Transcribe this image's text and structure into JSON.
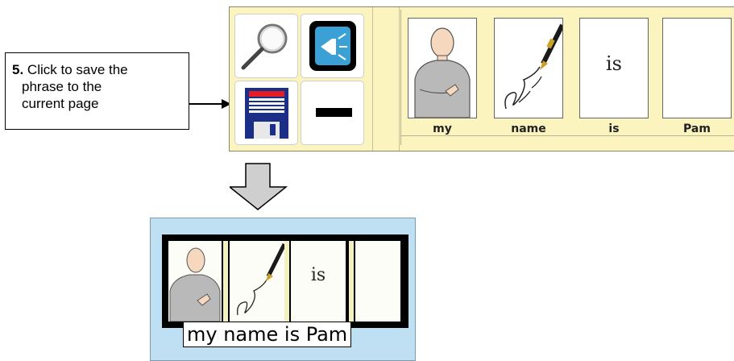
{
  "callout": {
    "step_number": "5.",
    "line1": "Click to save the",
    "line2": "phrase to the",
    "line3": "current page"
  },
  "toolbar": {
    "buttons": [
      {
        "icon": "magnifier-icon"
      },
      {
        "icon": "speak-icon"
      },
      {
        "icon": "floppy-disk-save-icon"
      },
      {
        "icon": "minus-icon"
      }
    ]
  },
  "phrase_strip": {
    "cards": [
      {
        "label": "my",
        "symbol": "person-pointing-self-icon"
      },
      {
        "label": "name",
        "symbol": "signature-pen-icon"
      },
      {
        "label": "is",
        "symbol_text": "is"
      },
      {
        "label": "Pam",
        "symbol": "blank"
      }
    ]
  },
  "result": {
    "symbol_is_text": "is",
    "phrase_text": "my name is Pam"
  },
  "colors": {
    "toolbar_bg": "#fbf4bf",
    "result_bg": "#bfe0f2",
    "save_blue": "#1c2f86",
    "save_red": "#e41c23",
    "speak_blue": "#3aa0d6"
  }
}
